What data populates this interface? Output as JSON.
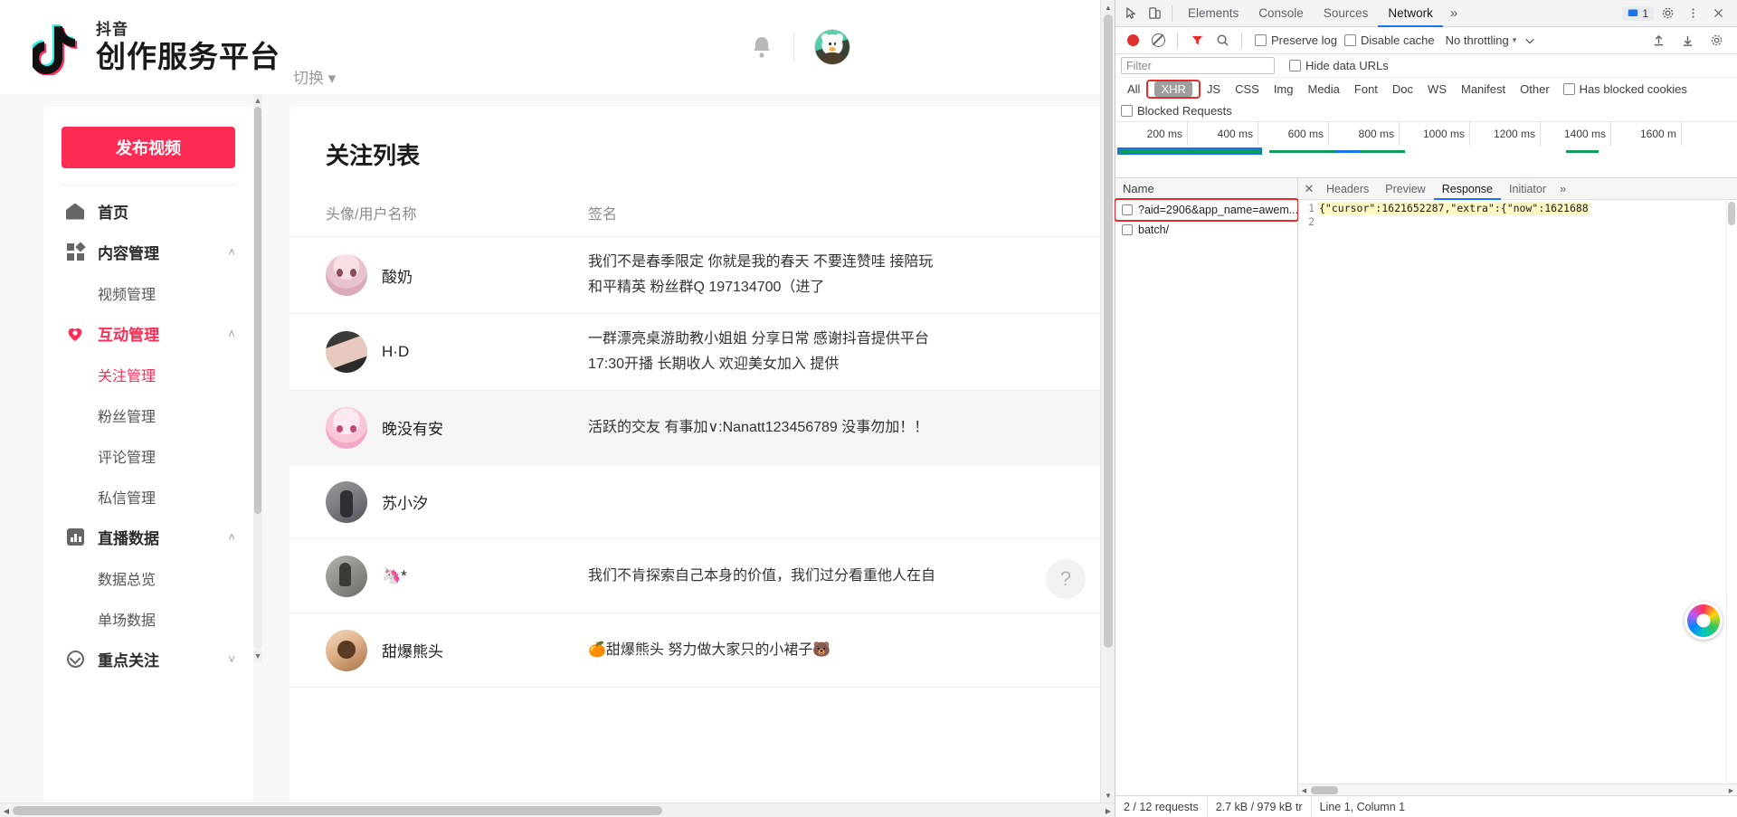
{
  "site": {
    "brand_sub": "抖音",
    "brand_main": "创作服务平台",
    "switch_label": "切换",
    "bell_icon": "bell-icon",
    "avatar_icon": "user-avatar"
  },
  "sidebar": {
    "publish_button": "发布视频",
    "items": [
      {
        "label": "首页",
        "icon": "home-icon",
        "type": "top",
        "expandable": false,
        "active": false
      },
      {
        "label": "内容管理",
        "icon": "grid-icon",
        "type": "top",
        "expandable": true,
        "chevron": "˄",
        "active": false
      },
      {
        "label": "视频管理",
        "type": "sub",
        "active": false
      },
      {
        "label": "互动管理",
        "icon": "heart-icon",
        "type": "top",
        "expandable": true,
        "chevron": "˄",
        "active": true
      },
      {
        "label": "关注管理",
        "type": "sub",
        "active": true
      },
      {
        "label": "粉丝管理",
        "type": "sub",
        "active": false
      },
      {
        "label": "评论管理",
        "type": "sub",
        "active": false
      },
      {
        "label": "私信管理",
        "type": "sub",
        "active": false
      },
      {
        "label": "直播数据",
        "icon": "bar-chart-icon",
        "type": "top",
        "expandable": true,
        "chevron": "˄",
        "active": false
      },
      {
        "label": "数据总览",
        "type": "sub",
        "active": false
      },
      {
        "label": "单场数据",
        "type": "sub",
        "active": false
      },
      {
        "label": "重点关注",
        "icon": "check-circle-icon",
        "type": "top",
        "expandable": true,
        "chevron": "˅",
        "active": false
      }
    ]
  },
  "main": {
    "page_title": "关注列表",
    "columns": {
      "user": "头像/用户名称",
      "signature": "签名"
    },
    "rows": [
      {
        "name": "酸奶",
        "avatar": "av1",
        "signature": "我们不是春季限定 你就是我的春天 不要连赞哇 接陪玩\n和平精英 粉丝群Q 197134700（进了",
        "highlighted": false
      },
      {
        "name": "H·D",
        "avatar": "av2",
        "signature": "一群漂亮桌游助教小姐姐 分享日常 感谢抖音提供平台\n17:30开播 长期收人 欢迎美女加入 提供",
        "highlighted": false
      },
      {
        "name": "晚没有安",
        "avatar": "av3",
        "signature": "活跃的交友 有事加∨:Nanatt123456789 没事勿加！！",
        "highlighted": true
      },
      {
        "name": "苏小汐",
        "avatar": "av4",
        "signature": "",
        "highlighted": false
      },
      {
        "name": "🦄*",
        "avatar": "av5",
        "signature": "我们不肯探索自己本身的价值，我们过分看重他人在自",
        "highlighted": false
      },
      {
        "name": "甜爆熊头",
        "avatar": "av6",
        "signature": "🍊甜爆熊头 努力做大家只的小裙子🐻",
        "highlighted": false
      }
    ],
    "help_button": "?"
  },
  "devtools": {
    "tabs": [
      {
        "label": "Elements",
        "active": false
      },
      {
        "label": "Console",
        "active": false
      },
      {
        "label": "Sources",
        "active": false
      },
      {
        "label": "Network",
        "active": true
      }
    ],
    "more_tabs_icon": "chevron-double-right-icon",
    "inspect_icon": "inspect-element-icon",
    "device_icon": "device-toolbar-icon",
    "issues_count": "1",
    "settings_icon": "gear-icon",
    "kebab_icon": "more-vertical-icon",
    "close_icon": "close-icon",
    "toolbar": {
      "record_icon": "record-stop-icon",
      "clear_icon": "clear-icon",
      "filter_icon": "funnel-icon",
      "search_icon": "search-icon",
      "preserve_log": "Preserve log",
      "disable_cache": "Disable cache",
      "throttling": "No throttling",
      "throttle_caret": "▾",
      "network_conditions_icon": "network-conditions-icon",
      "import_har_icon": "import-har-icon",
      "export_har_icon": "export-har-icon",
      "settings_icon": "settings-gear-icon"
    },
    "filter": {
      "placeholder": "Filter",
      "value": "",
      "hide_data_urls": "Hide data URLs"
    },
    "types": [
      {
        "label": "All",
        "active": false,
        "highlighted": false
      },
      {
        "label": "XHR",
        "active": true,
        "highlighted": true
      },
      {
        "label": "JS",
        "active": false,
        "highlighted": false
      },
      {
        "label": "CSS",
        "active": false,
        "highlighted": false
      },
      {
        "label": "Img",
        "active": false,
        "highlighted": false
      },
      {
        "label": "Media",
        "active": false,
        "highlighted": false
      },
      {
        "label": "Font",
        "active": false,
        "highlighted": false
      },
      {
        "label": "Doc",
        "active": false,
        "highlighted": false
      },
      {
        "label": "WS",
        "active": false,
        "highlighted": false
      },
      {
        "label": "Manifest",
        "active": false,
        "highlighted": false
      },
      {
        "label": "Other",
        "active": false,
        "highlighted": false
      }
    ],
    "has_blocked_cookies": "Has blocked cookies",
    "blocked_requests": "Blocked Requests",
    "timeline_ticks": [
      "200 ms",
      "400 ms",
      "600 ms",
      "800 ms",
      "1000 ms",
      "1200 ms",
      "1400 ms",
      "1600 m"
    ],
    "requests_header": "Name",
    "requests": [
      {
        "name": "?aid=2906&app_name=awem...",
        "selected": true
      },
      {
        "name": "batch/",
        "selected": false
      }
    ],
    "detail_tabs": [
      {
        "label": "Headers",
        "active": false
      },
      {
        "label": "Preview",
        "active": false
      },
      {
        "label": "Response",
        "active": true
      },
      {
        "label": "Initiator",
        "active": false
      }
    ],
    "detail_more_icon": "chevron-double-right-icon",
    "detail_close_icon": "close-icon",
    "response": {
      "line_numbers": [
        "1",
        "2"
      ],
      "lines": [
        "{\"cursor\":1621652287,\"extra\":{\"now\":1621688",
        ""
      ]
    },
    "status": {
      "requests": "2 / 12 requests",
      "transferred": "2.7 kB / 979 kB tr",
      "cursor": "Line 1, Column 1"
    }
  }
}
